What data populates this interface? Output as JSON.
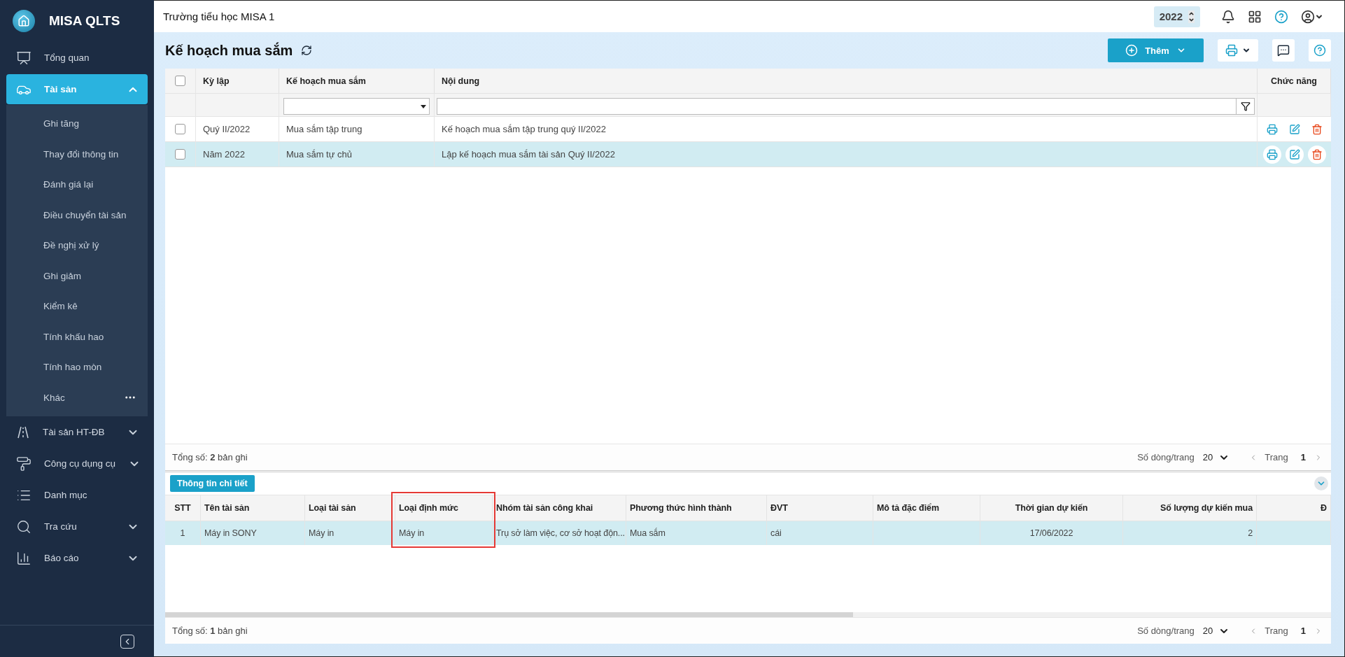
{
  "sidebar": {
    "logo": "MISA QLTS",
    "items": [
      {
        "label": "Tổng quan",
        "kind": "link",
        "selected": false
      },
      {
        "label": "Tài sản",
        "kind": "group",
        "selected": true,
        "expanded": true,
        "children": [
          {
            "label": "Ghi tăng",
            "more": false
          },
          {
            "label": "Thay đổi thông tin",
            "more": false
          },
          {
            "label": "Đánh giá lại",
            "more": false
          },
          {
            "label": "Điều chuyển tài sản",
            "more": false
          },
          {
            "label": "Đề nghị xử lý",
            "more": false
          },
          {
            "label": "Ghi giảm",
            "more": false
          },
          {
            "label": "Kiểm kê",
            "more": false
          },
          {
            "label": "Tính khấu hao",
            "more": false
          },
          {
            "label": "Tính hao mòn",
            "more": false
          },
          {
            "label": "Khác",
            "more": true
          }
        ]
      },
      {
        "label": "Tài sản HT-ĐB",
        "kind": "group",
        "selected": false,
        "expanded": false
      },
      {
        "label": "Công cụ dụng cụ",
        "kind": "group",
        "selected": false,
        "expanded": false
      },
      {
        "label": "Danh mục",
        "kind": "link",
        "selected": false
      },
      {
        "label": "Tra cứu",
        "kind": "group",
        "selected": false,
        "expanded": false
      },
      {
        "label": "Báo cáo",
        "kind": "group",
        "selected": false,
        "expanded": false
      }
    ]
  },
  "header": {
    "school": "Trường tiểu học MISA 1",
    "year": "2022"
  },
  "page": {
    "title": "Kế hoạch mua sắm",
    "add_button": "Thêm"
  },
  "plans_table": {
    "all_checked": false,
    "columns": [
      "Kỳ lập",
      "Kế hoạch mua sắm",
      "Nội dung",
      "Chức năng"
    ],
    "rows": [
      {
        "cells": [
          "Quý II/2022",
          "Mua sắm tập trung",
          "Kế hoạch mua sắm tập trung quý II/2022"
        ],
        "checked": false,
        "selected": false
      },
      {
        "cells": [
          "Năm 2022",
          "Mua sắm tự chủ",
          "Lập kế hoạch mua sắm tài sản Quý II/2022"
        ],
        "checked": false,
        "selected": true
      }
    ],
    "footer": {
      "total": "Tổng số: **2** bản ghi",
      "page_size_label": "Số dòng/trang",
      "page_size": "20",
      "page_label": "Trang",
      "page": "1"
    }
  },
  "detail": {
    "tab": "Thông tin chi tiết",
    "columns": [
      {
        "label": "STT",
        "highlighted": false
      },
      {
        "label": "Tên tài sản",
        "highlighted": false
      },
      {
        "label": "Loại tài sản",
        "highlighted": false
      },
      {
        "label": "Loại định mức",
        "highlighted": true
      },
      {
        "label": "Nhóm tài sản công khai",
        "highlighted": false
      },
      {
        "label": "Phương thức hình thành",
        "highlighted": false
      },
      {
        "label": "ĐVT",
        "highlighted": false
      },
      {
        "label": "Mô tả đặc điểm",
        "highlighted": false
      },
      {
        "label": "Thời gian dự kiến",
        "highlighted": false
      },
      {
        "label": "Số lượng dự kiến mua",
        "highlighted": false
      },
      {
        "label": "Đ",
        "highlighted": false
      }
    ],
    "rows": [
      {
        "cells": [
          "1",
          "Máy in SONY",
          "Máy in",
          "Máy in",
          "Trụ sở làm việc, cơ sở hoạt độn...",
          "Mua sắm",
          "cái",
          "",
          "17/06/2022",
          "2",
          ""
        ],
        "selected": true
      }
    ],
    "footer": {
      "total": "Tổng số: **1** bản ghi",
      "page_size_label": "Số dòng/trang",
      "page_size": "20",
      "page_label": "Trang",
      "page": "1"
    }
  }
}
